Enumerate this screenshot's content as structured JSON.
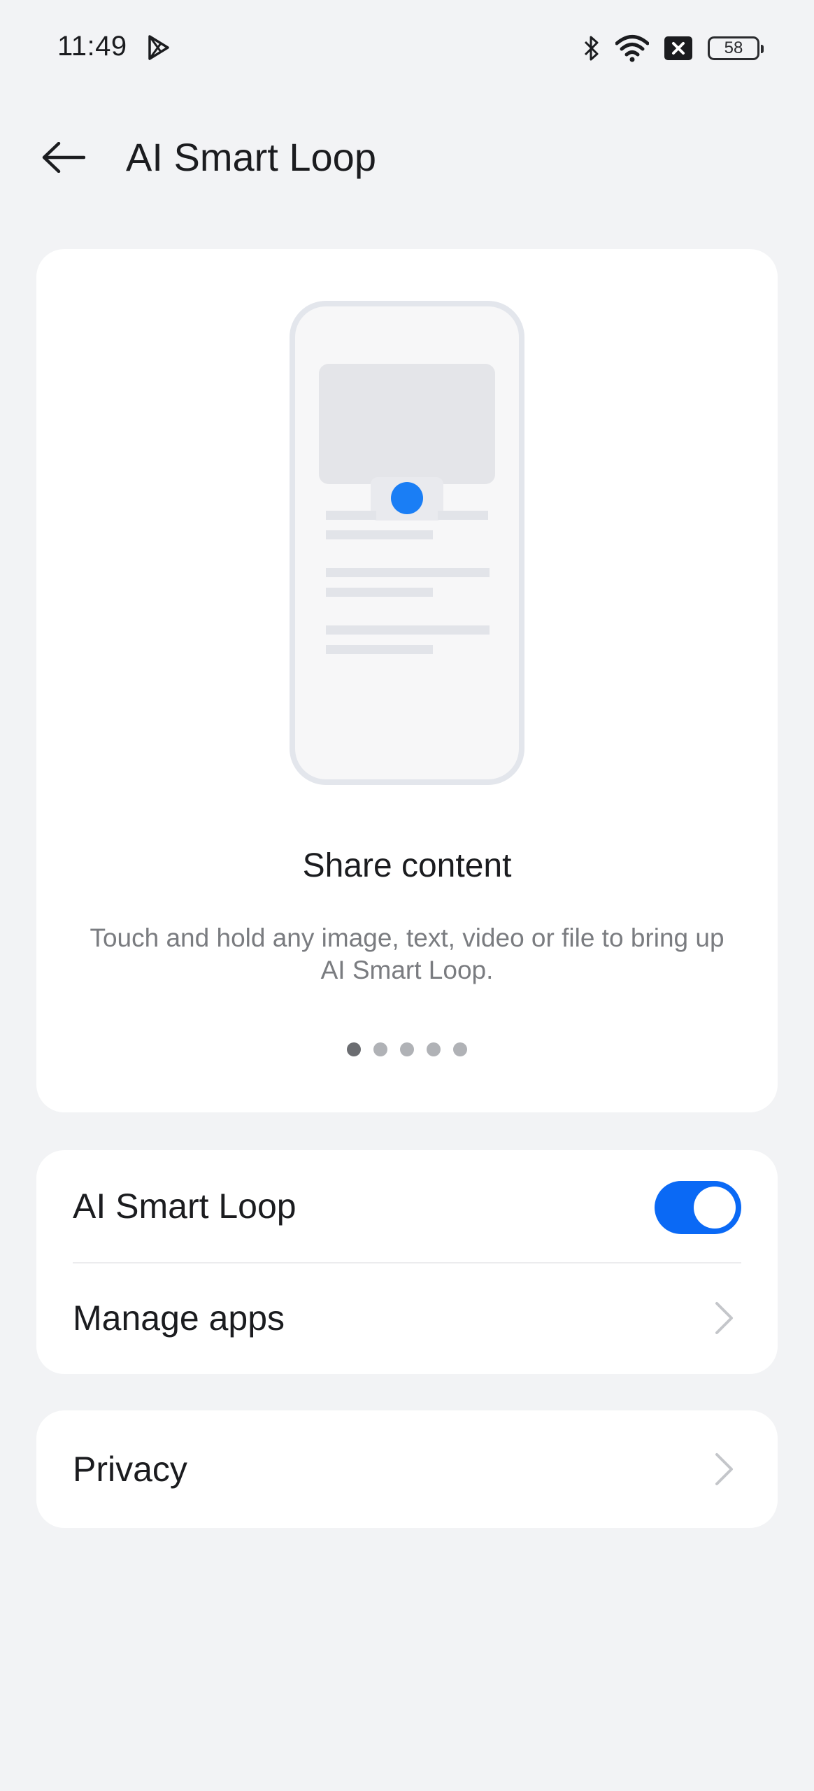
{
  "status_bar": {
    "time": "11:49",
    "battery_level": "58",
    "icons": [
      "play-store-icon",
      "bluetooth-icon",
      "wifi-icon",
      "no-sim-icon",
      "battery-icon"
    ]
  },
  "header": {
    "back_icon": "arrow-left-icon",
    "title": "AI Smart Loop"
  },
  "intro_card": {
    "slide_title": "Share content",
    "slide_description": "Touch and hold any image, text, video or file to bring up AI Smart Loop.",
    "pager": {
      "total": 5,
      "active_index": 0
    },
    "accent_color": "#1a7ef5"
  },
  "settings": {
    "smart_loop_label": "AI Smart Loop",
    "smart_loop_enabled": true,
    "manage_apps_label": "Manage apps",
    "toggle_color": "#0a69f5"
  },
  "privacy": {
    "label": "Privacy"
  }
}
